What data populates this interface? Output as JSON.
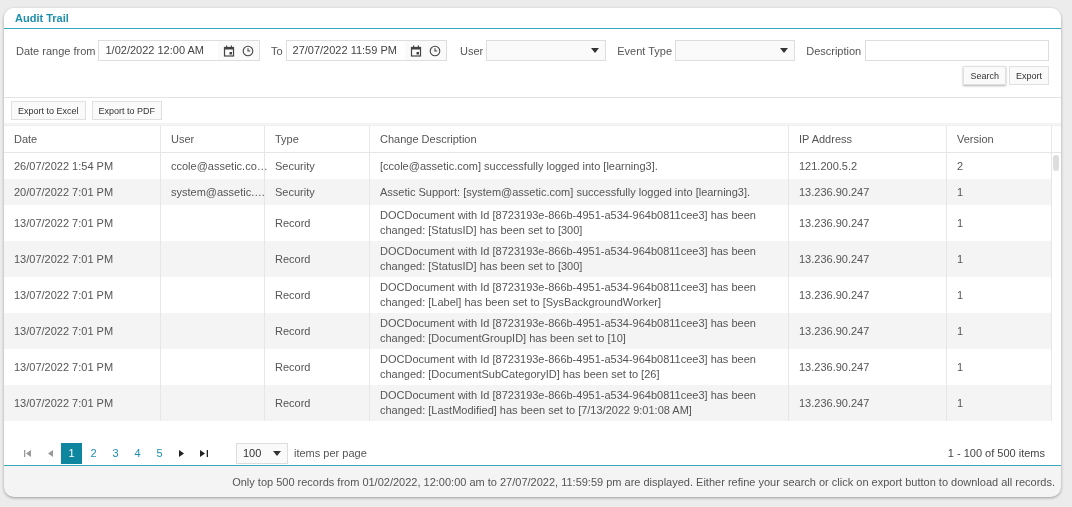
{
  "panel": {
    "title": "Audit Trail"
  },
  "filters": {
    "date_from_label": "Date range from",
    "date_from": "1/02/2022 12:00 AM",
    "date_to_label": "To",
    "date_to": "27/07/2022 11:59 PM",
    "user_label": "User",
    "event_type_label": "Event Type",
    "description_label": "Description",
    "buttons": [
      "Search",
      "Export"
    ]
  },
  "export_buttons": [
    "Export to Excel",
    "Export to PDF"
  ],
  "table": {
    "columns": [
      "Date",
      "User",
      "Type",
      "Change Description",
      "IP Address",
      "Version"
    ],
    "rows": [
      [
        "26/07/2022 1:54 PM",
        "ccole@assetic.co…",
        "Security",
        "[ccole@assetic.com] successfully logged into [learning3].",
        "121.200.5.2",
        "2"
      ],
      [
        "20/07/2022 7:01 PM",
        "system@assetic.…",
        "Security",
        "Assetic Support: [system@assetic.com] successfully logged into [learning3].",
        "13.236.90.247",
        "1"
      ],
      [
        "13/07/2022 7:01 PM",
        "",
        "Record",
        "DOCDocument with Id [8723193e-866b-4951-a534-964b0811cee3] has been changed: [StatusID] has been set to [300]",
        "13.236.90.247",
        "1"
      ],
      [
        "13/07/2022 7:01 PM",
        "",
        "Record",
        "DOCDocument with Id [8723193e-866b-4951-a534-964b0811cee3] has been changed: [StatusID] has been set to [300]",
        "13.236.90.247",
        "1"
      ],
      [
        "13/07/2022 7:01 PM",
        "",
        "Record",
        "DOCDocument with Id [8723193e-866b-4951-a534-964b0811cee3] has been changed: [Label] has been set to [SysBackgroundWorker]",
        "13.236.90.247",
        "1"
      ],
      [
        "13/07/2022 7:01 PM",
        "",
        "Record",
        "DOCDocument with Id [8723193e-866b-4951-a534-964b0811cee3] has been changed: [DocumentGroupID] has been set to [10]",
        "13.236.90.247",
        "1"
      ],
      [
        "13/07/2022 7:01 PM",
        "",
        "Record",
        "DOCDocument with Id [8723193e-866b-4951-a534-964b0811cee3] has been changed: [DocumentSubCategoryID] has been set to [26]",
        "13.236.90.247",
        "1"
      ],
      [
        "13/07/2022 7:01 PM",
        "",
        "Record",
        "DOCDocument with Id [8723193e-866b-4951-a534-964b0811cee3] has been changed: [LastModified] has been set to [7/13/2022 9:01:08 AM]",
        "13.236.90.247",
        "1"
      ]
    ]
  },
  "pager": {
    "pages": [
      {
        "label": "1",
        "selected": true
      },
      {
        "label": "2",
        "selected": false
      },
      {
        "label": "3",
        "selected": false
      },
      {
        "label": "4",
        "selected": false
      },
      {
        "label": "5",
        "selected": false
      }
    ],
    "page_size": "100",
    "page_size_label": "items per page",
    "summary": "1 - 100 of 500 items"
  },
  "notice": "Only top 500 records from 01/02/2022, 12:00:00 am to 27/07/2022, 11:59:59 pm are displayed. Either refine your search or click on export button to download all records."
}
